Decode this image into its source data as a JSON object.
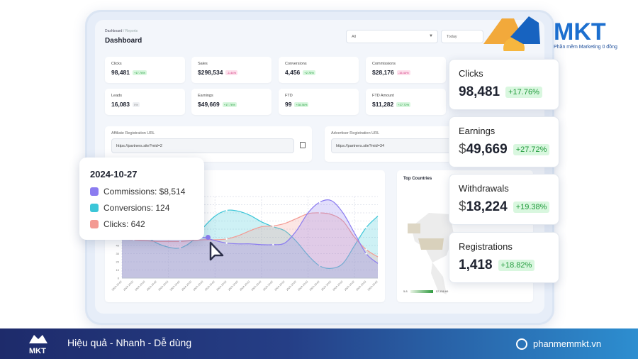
{
  "brand": {
    "name": "MKT",
    "tagline": "Phần mềm Marketing 0 đồng"
  },
  "header": {
    "breadcrumb": [
      "Dashboard",
      "/",
      "Reports"
    ],
    "title": "Dashboard",
    "filter_value": "All",
    "date_value": "Today"
  },
  "stats": [
    {
      "label": "Clicks",
      "value": "98,481",
      "change": "+17.76%",
      "trend": "up"
    },
    {
      "label": "Sales",
      "value": "$298,534",
      "change": "-1.44%",
      "trend": "down"
    },
    {
      "label": "Conversions",
      "value": "4,456",
      "change": "+2.75%",
      "trend": "up"
    },
    {
      "label": "Commissions",
      "value": "$28,176",
      "change": "-15.44%",
      "trend": "down"
    },
    {
      "label": "Leads",
      "value": "16,083",
      "change": "0%",
      "trend": "neutral"
    },
    {
      "label": "Earnings",
      "value": "$49,669",
      "change": "+17.76%",
      "trend": "up"
    },
    {
      "label": "FTD",
      "value": "99",
      "change": "+28.36%",
      "trend": "up"
    },
    {
      "label": "FTD Amount",
      "value": "$11,282",
      "change": "+27.72%",
      "trend": "up"
    }
  ],
  "urls": {
    "affiliate_label": "Affiliate Registration URL",
    "affiliate_value": "https://partners.site?mid=2",
    "advertiser_label": "Advertiser Registration URL",
    "advertiser_value": "https://partners.site?mid=34"
  },
  "highlight_cards": [
    {
      "label": "Clicks",
      "currency": "",
      "value": "98,481",
      "change": "+17.76%"
    },
    {
      "label": "Earnings",
      "currency": "$",
      "value": "49,669",
      "change": "+27.72%"
    },
    {
      "label": "Withdrawals",
      "currency": "$",
      "value": "18,224",
      "change": "+19.38%"
    },
    {
      "label": "Registrations",
      "currency": "",
      "value": "1,418",
      "change": "+18.82%"
    }
  ],
  "tooltip": {
    "date": "2024-10-27",
    "items": [
      "Commissions: $8,514",
      "Conversions: 124",
      "Clicks: 642"
    ]
  },
  "map": {
    "title": "Top Countries",
    "legend_min": "5.8",
    "legend_max": "12,156.66"
  },
  "colors": {
    "commissions": "#8b7cf0",
    "conversions": "#3cc6d8",
    "clicks": "#f39a93",
    "accent": "#2b61c9"
  },
  "chart_data": {
    "type": "area",
    "ylim": [
      0,
      100
    ],
    "y_ticks": [
      "0",
      "10",
      "20",
      "30",
      "40"
    ],
    "categories": [
      "2024-10-02",
      "2024-10-02",
      "2024-10-02",
      "2024-10-02",
      "2024-10-02",
      "2024-10-02",
      "2024-10-02",
      "2024-10-02",
      "2024-10-02",
      "2024-10-02",
      "2024-10-02",
      "2024-10-02",
      "2024-10-02",
      "2024-10-02",
      "2024-10-02",
      "2024-10-02",
      "2024-10-02",
      "2024-10-02",
      "2024-10-02",
      "2024-10-02",
      "2024-10-02",
      "2024-10-02",
      "2024-10-02"
    ],
    "series": [
      {
        "name": "Conversions",
        "values": [
          70,
          62,
          52,
          43,
          38,
          37,
          45,
          62,
          76,
          83,
          82,
          77,
          69,
          63,
          58,
          45,
          28,
          15,
          12,
          18,
          40,
          62,
          76
        ]
      },
      {
        "name": "Clicks",
        "values": [
          48,
          47,
          46,
          45,
          45,
          45,
          46,
          47,
          47,
          48,
          52,
          58,
          63,
          64,
          67,
          73,
          79,
          80,
          78,
          70,
          50,
          35,
          26
        ]
      },
      {
        "name": "Commissions",
        "values": [
          55,
          54,
          53,
          52,
          51,
          51,
          51,
          50,
          46,
          43,
          42,
          42,
          41,
          41,
          43,
          58,
          80,
          93,
          95,
          80,
          55,
          30,
          18
        ]
      }
    ],
    "grid": true
  },
  "footer": {
    "tagline": "Hiệu quả - Nhanh - Dễ dùng",
    "website": "phanmemmkt.vn"
  }
}
